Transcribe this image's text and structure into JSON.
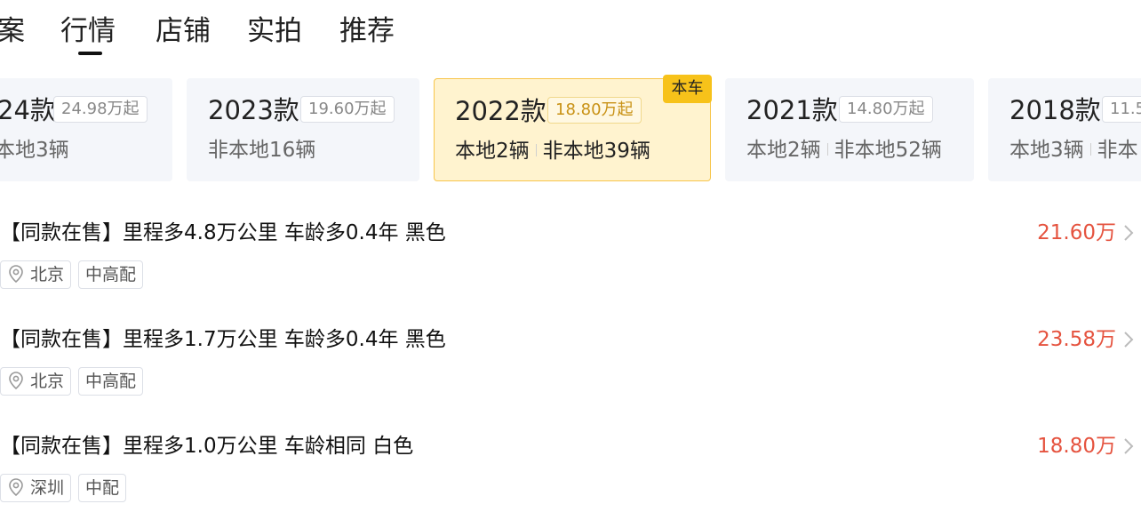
{
  "tabs": [
    {
      "label": "案",
      "active": false
    },
    {
      "label": "行情",
      "active": true
    },
    {
      "label": "店铺",
      "active": false
    },
    {
      "label": "实拍",
      "active": false
    },
    {
      "label": "推荐",
      "active": false
    }
  ],
  "model_years": [
    {
      "year": "24款",
      "price": "24.98万起",
      "local": "",
      "nonlocal": "本地3辆",
      "active": false
    },
    {
      "year": "2023款",
      "price": "19.60万起",
      "local": "",
      "nonlocal": "非本地16辆",
      "active": false
    },
    {
      "year": "2022款",
      "price": "18.80万起",
      "local": "本地2辆",
      "nonlocal": "非本地39辆",
      "active": true
    },
    {
      "year": "2021款",
      "price": "14.80万起",
      "local": "本地2辆",
      "nonlocal": "非本地52辆",
      "active": false
    },
    {
      "year": "2018款",
      "price": "11.5",
      "local": "本地3辆",
      "nonlocal": "非本",
      "active": false
    }
  ],
  "current_badge": "本车",
  "listings": [
    {
      "title": "【同款在售】里程多4.8万公里 车龄多0.4年 黑色",
      "city": "北京",
      "trim": "中高配",
      "price": "21.60万"
    },
    {
      "title": "【同款在售】里程多1.7万公里 车龄多0.4年 黑色",
      "city": "北京",
      "trim": "中高配",
      "price": "23.58万"
    },
    {
      "title": "【同款在售】里程多1.0万公里 车龄相同 白色",
      "city": "深圳",
      "trim": "中配",
      "price": "18.80万"
    }
  ],
  "colors": {
    "accent": "#f7c21a",
    "price": "#e5533f",
    "card_bg": "#f4f6fa",
    "active_card_bg": "#fff3cf"
  }
}
